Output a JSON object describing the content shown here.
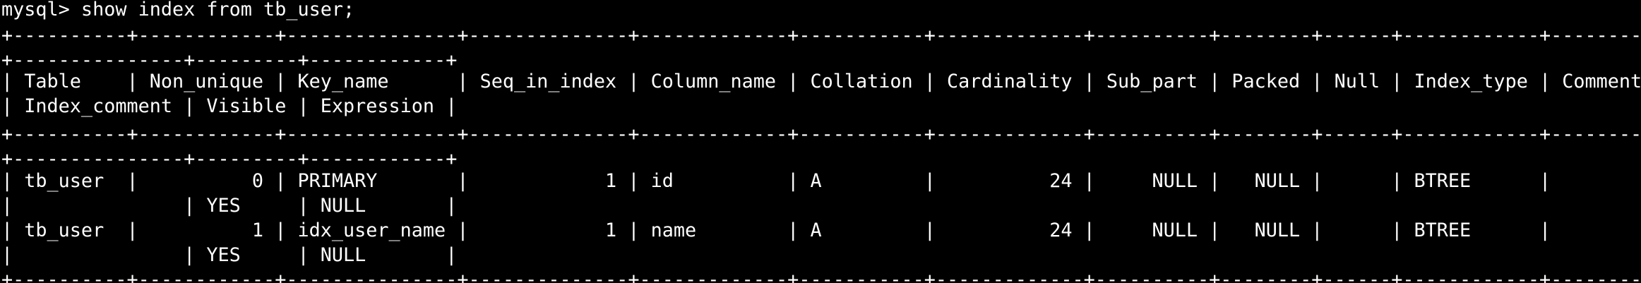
{
  "terminal": {
    "lines": [
      "mysql> show index from tb_user;",
      "+----------+------------+---------------+--------------+-------------+-----------+-------------+----------+--------+------+------------+---------",
      "+---------------+---------+------------+",
      "| Table    | Non_unique | Key_name      | Seq_in_index | Column_name | Collation | Cardinality | Sub_part | Packed | Null | Index_type | Comment",
      "| Index_comment | Visible | Expression |",
      "+----------+------------+---------------+--------------+-------------+-----------+-------------+----------+--------+------+------------+---------",
      "+---------------+---------+------------+",
      "| tb_user  |          0 | PRIMARY       |            1 | id          | A         |          24 |     NULL |   NULL |      | BTREE      |",
      "|               | YES     | NULL       |",
      "| tb_user  |          1 | idx_user_name |            1 | name        | A         |          24 |     NULL |   NULL |      | BTREE      |",
      "|               | YES     | NULL       |",
      "+----------+------------+---------------+--------------+-------------+-----------+-------------+----------+--------+------+------------+---------"
    ]
  },
  "colors": {
    "background": "#000000",
    "text": "#ffffff"
  }
}
